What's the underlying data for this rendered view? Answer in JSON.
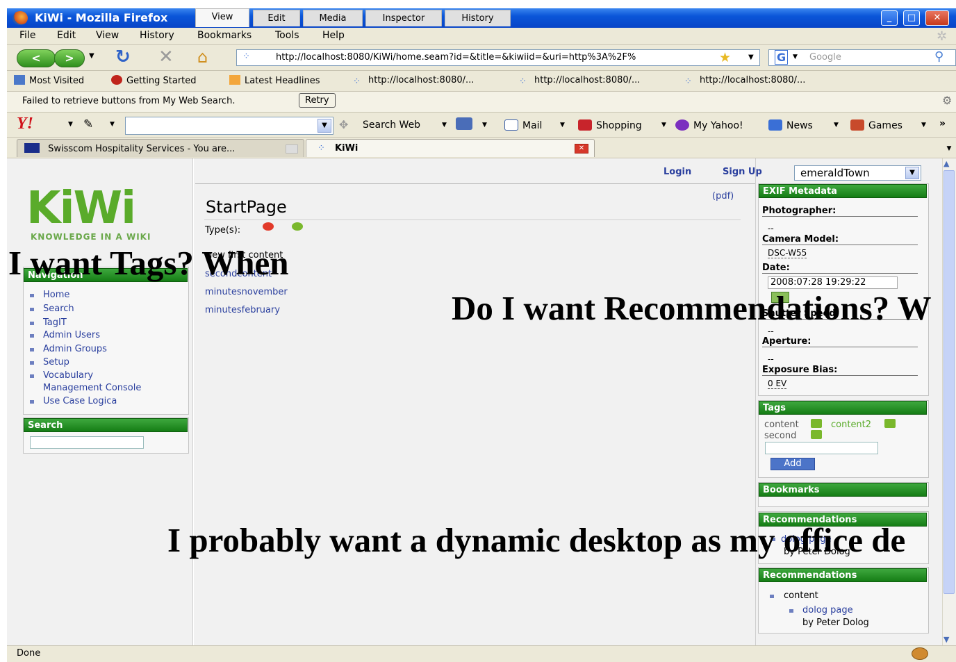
{
  "window": {
    "title": "KiWi - Mozilla Firefox"
  },
  "menu": [
    "File",
    "Edit",
    "View",
    "History",
    "Bookmarks",
    "Tools",
    "Help"
  ],
  "navbar": {
    "url": "http://localhost:8080/KiWi/home.seam?id=&title=&kiwiid=&uri=http%3A%2F%",
    "search_placeholder": "Google"
  },
  "bookmarks": [
    "Most Visited",
    "Getting Started",
    "Latest Headlines",
    "http://localhost:8080/...",
    "http://localhost:8080/...",
    "http://localhost:8080/..."
  ],
  "infobar": {
    "message": "Failed to retrieve buttons from My Web Search.",
    "retry": "Retry"
  },
  "yahoo": {
    "logo": "Y!",
    "search_web": "Search Web",
    "mail": "Mail",
    "shopping": "Shopping",
    "my_yahoo": "My Yahoo!",
    "news": "News",
    "games": "Games",
    "more": "»"
  },
  "tabs": [
    {
      "label": "Swisscom Hospitality Services - You are..."
    },
    {
      "label": "KiWi"
    }
  ],
  "logo": {
    "text": "KiWi",
    "tagline": "KNOWLEDGE IN A WIKI"
  },
  "navigation": {
    "heading": "Navigation",
    "items": [
      "Home",
      "Search",
      "TagIT",
      "Admin Users",
      "Admin Groups",
      "Setup",
      "Vocabulary",
      "Management Console",
      "Use Case Logica"
    ]
  },
  "search_box": {
    "heading": "Search"
  },
  "page_tabs": [
    "View",
    "Edit",
    "Media",
    "Inspector",
    "History"
  ],
  "auth": {
    "login": "Login",
    "signup": "Sign Up",
    "user_select": "emeraldTown"
  },
  "content": {
    "pdf": "(pdf)",
    "title": "StartPage",
    "types_label": "Type(s):",
    "new_content": "new first content",
    "links": [
      "secondcontent",
      "minutesnovember",
      "minutesfebruary"
    ]
  },
  "exif": {
    "heading": "EXIF Metadata",
    "fields": [
      {
        "label": "Photographer:",
        "value": "--"
      },
      {
        "label": "Camera Model:",
        "value": "DSC-W55"
      },
      {
        "label": "Date:",
        "value": "2008:07:28 19:29:22"
      },
      {
        "label": "Shutter Speed:",
        "value": "--"
      },
      {
        "label": "Aperture:",
        "value": "--"
      },
      {
        "label": "Exposure Bias:",
        "value": "0 EV"
      }
    ]
  },
  "tags": {
    "heading": "Tags",
    "items": [
      "content",
      "content2",
      "second"
    ],
    "add_button": "Add"
  },
  "bookmarks_box": {
    "heading": "Bookmarks"
  },
  "recommendations1": {
    "heading": "Recommendations",
    "item": "dolog page",
    "author": "by Peter Dolog"
  },
  "recommendations2": {
    "heading": "Recommendations",
    "parent": "content",
    "item": "dolog page",
    "author": "by Peter Dolog"
  },
  "status": {
    "text": "Done"
  },
  "overlay": [
    "I want Tags? When",
    "Do I want Recommendations? W",
    "I probably want a dynamic desktop as my office de"
  ],
  "colors": {
    "accent_green": "#1a8a1a",
    "link_blue": "#2a3f9e",
    "titlebar_blue": "#0a55d8"
  }
}
